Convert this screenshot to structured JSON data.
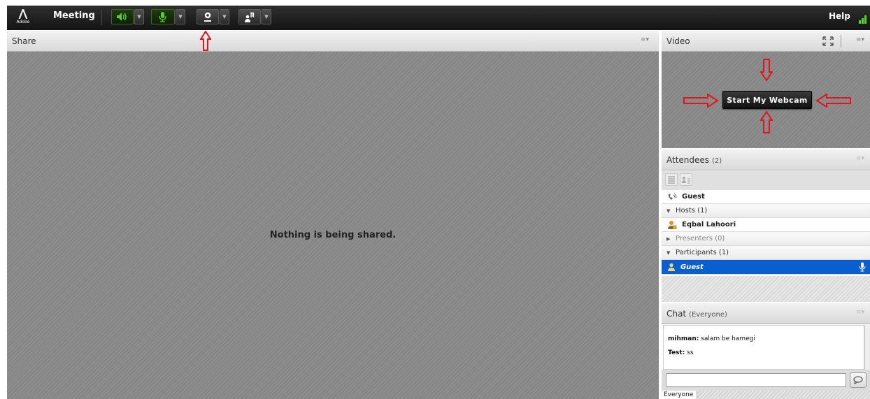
{
  "app": {
    "logo_text": "Adobe",
    "menu": {
      "meeting": "Meeting",
      "help": "Help"
    }
  },
  "share_pod": {
    "title": "Share",
    "message": "Nothing is being shared."
  },
  "video_pod": {
    "title": "Video",
    "start_webcam": "Start My Webcam"
  },
  "attendees_pod": {
    "title": "Attendees",
    "count": "(2)",
    "rows": [
      {
        "label": "Guest",
        "kind": "user"
      },
      {
        "label": "Hosts (1)",
        "kind": "group"
      },
      {
        "label": "Eqbal Lahoori",
        "kind": "user"
      },
      {
        "label": "Presenters (0)",
        "kind": "group-collapsed"
      },
      {
        "label": "Participants (1)",
        "kind": "group"
      },
      {
        "label": "Guest",
        "kind": "selected"
      }
    ]
  },
  "chat_pod": {
    "title": "Chat",
    "scope": "(Everyone)",
    "messages": [
      {
        "sender": "mihman:",
        "text": "salam be hamegi"
      },
      {
        "sender": "Test:",
        "text": "ss"
      }
    ],
    "tab_everyone": "Everyone"
  },
  "icons": {
    "audio": "speaker-icon",
    "microphone": "microphone-icon",
    "camera": "webcam-icon",
    "status": "raise-hand-icon"
  },
  "colors": {
    "accent_green": "#5ecb2a",
    "selection_blue": "#0a5fd0",
    "annotation_red": "#e3141b"
  }
}
